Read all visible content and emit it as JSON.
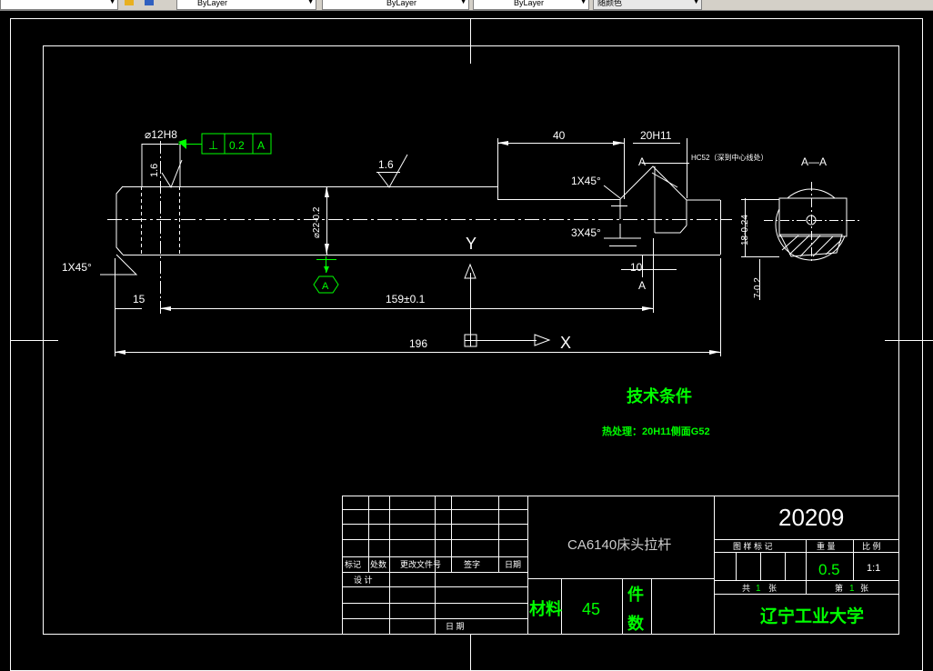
{
  "toolbar": {
    "layer_dropdown": "ByLayer",
    "linetype_dropdown": "ByLayer",
    "lineweight_dropdown": "ByLayer",
    "plotstyle_dropdown": "随颜色"
  },
  "drawing": {
    "dims": {
      "dia_hole": "⌀12H8",
      "perp_sym": "⊥",
      "perp_tol": "0.2",
      "perp_datum": "A",
      "rough_left": "1.6",
      "rough_top": "1.6",
      "chamfer_left": "1X45°",
      "len_15": "15",
      "len_159": "159±0.1",
      "len_196": "196",
      "len_40": "40",
      "slot_20": "20H11",
      "section_a_top": "A",
      "section_a_bottom": "A",
      "hardness": "HC52（深到中心线处）",
      "chamfer_top": "1X45°",
      "chamfer_bottom": "3X45°",
      "len_10": "10",
      "dia_22": "⌀22-0.2",
      "section_title": "A—A",
      "dim_18": "18-0.24",
      "dim_7": "7-0.2",
      "datum_a": "A",
      "axis_y": "Y",
      "axis_x": "X"
    },
    "notes": {
      "title": "技术条件",
      "heat": "热处理：20H11侧面G52"
    }
  },
  "titleblock": {
    "part_name": "CA6140床头拉杆",
    "drawing_no": "20209",
    "material_label": "材料",
    "material_value": "45",
    "qty_label_1": "件",
    "qty_label_2": "数",
    "col_mark": "标记",
    "col_count": "处数",
    "col_docno": "更改文件号",
    "col_sign": "签字",
    "col_date": "日期",
    "design": "设 计",
    "date": "日 期",
    "h_stage": "图 样 标 记",
    "h_weight": "重 量",
    "h_scale": "比 例",
    "weight": "0.5",
    "scale": "1:1",
    "sheets_total_pre": "共",
    "sheets_total": "1",
    "sheets_total_post": "张",
    "sheet_no_pre": "第",
    "sheet_no": "1",
    "sheet_no_post": "张",
    "school": "辽宁工业大学"
  },
  "colors": {
    "line": "#ffffff",
    "accent": "#00ff00",
    "background": "#000000"
  }
}
